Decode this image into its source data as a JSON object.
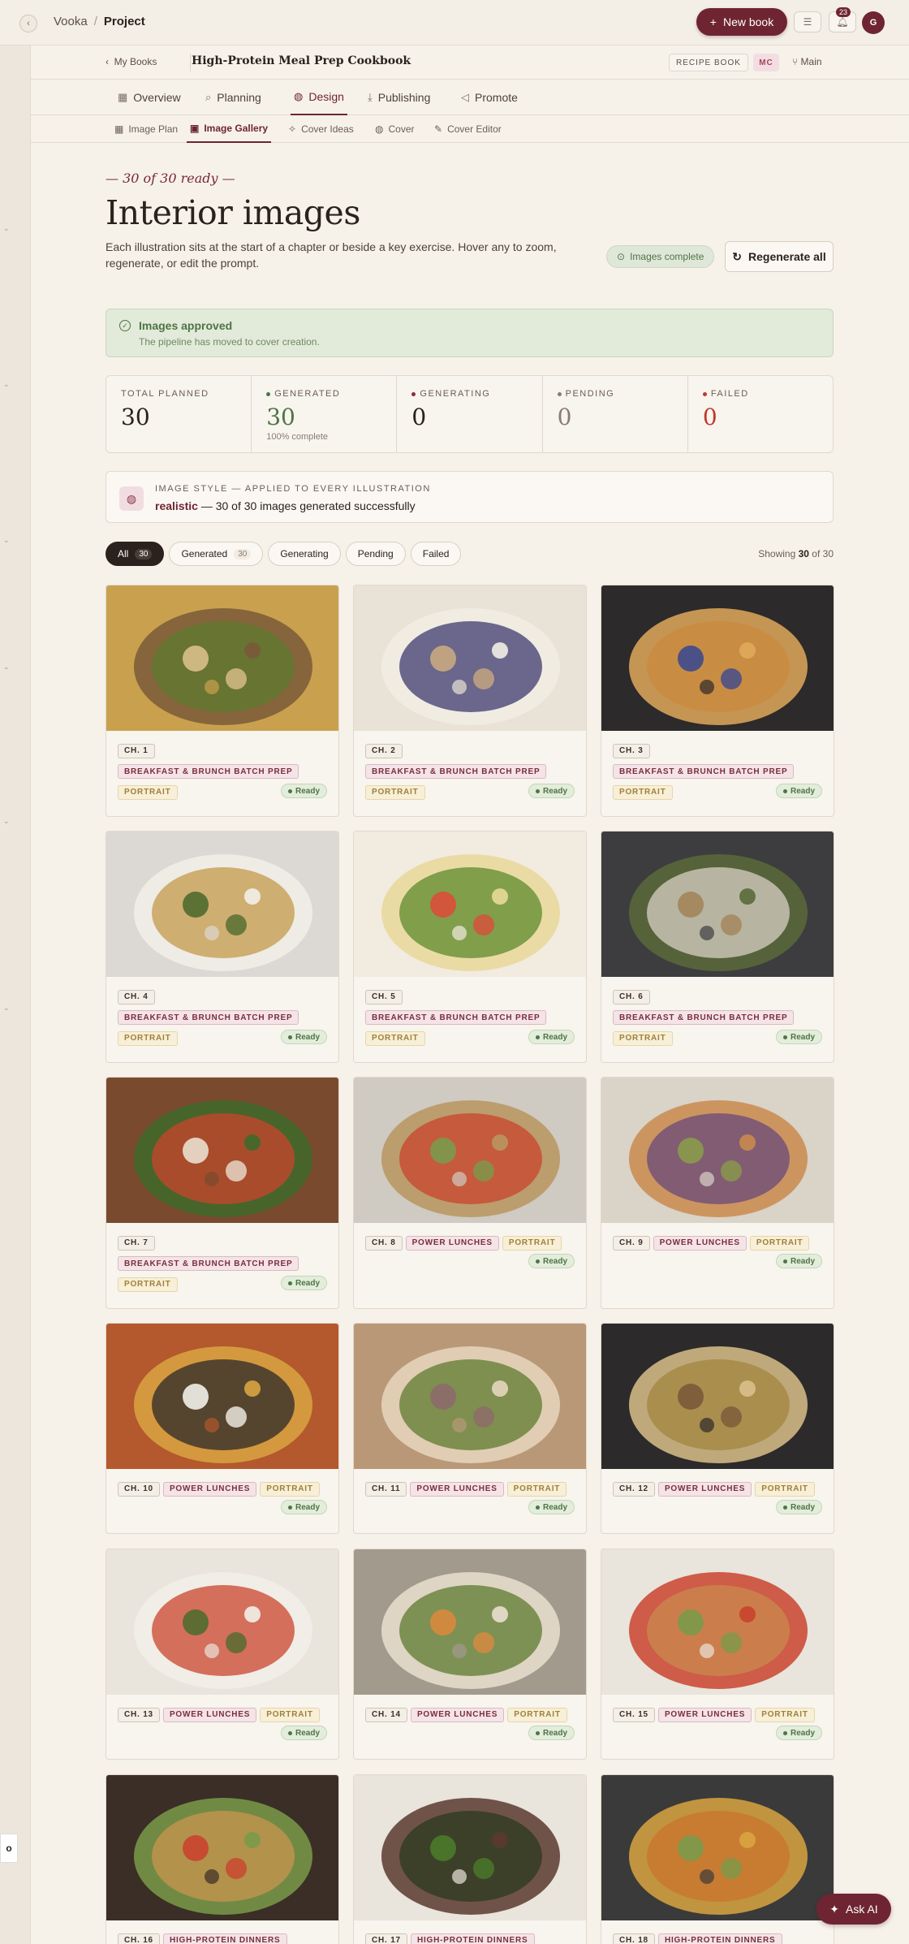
{
  "topbar": {
    "brand": "Vooka",
    "separator": "/",
    "current": "Project",
    "new_book_label": "New book",
    "notifications_count": "23",
    "avatar_initial": "G"
  },
  "bookbar": {
    "my_books": "My Books",
    "book_title": "High-Protein Meal Prep Cookbook",
    "type_tag": "RECIPE BOOK",
    "user_tag": "MC",
    "branch": "Main"
  },
  "tabs": [
    {
      "label": "Overview",
      "icon": "grid-icon"
    },
    {
      "label": "Planning",
      "icon": "search-icon"
    },
    {
      "label": "Design",
      "icon": "palette-icon"
    },
    {
      "label": "Publishing",
      "icon": "download-icon"
    },
    {
      "label": "Promote",
      "icon": "megaphone-icon"
    }
  ],
  "subtabs": [
    {
      "label": "Image Plan"
    },
    {
      "label": "Image Gallery"
    },
    {
      "label": "Cover Ideas"
    },
    {
      "label": "Cover"
    },
    {
      "label": "Cover Editor"
    }
  ],
  "header": {
    "eyebrow": "— 30 of 30 ready —",
    "title": "Interior images",
    "intro": "Each illustration sits at the start of a chapter or beside a key exercise. Hover any to zoom, regenerate, or edit the prompt.",
    "complete_pill": "Images complete",
    "regenerate_label": "Regenerate all"
  },
  "approved": {
    "title": "Images approved",
    "subtitle": "The pipeline has moved to cover creation."
  },
  "stats": [
    {
      "label": "TOTAL PLANNED",
      "value": "30",
      "sub": "",
      "dot": ""
    },
    {
      "label": "GENERATED",
      "value": "30",
      "sub": "100% complete",
      "dot": "#4f7445"
    },
    {
      "label": "GENERATING",
      "value": "0",
      "sub": "",
      "dot": "#8a2c3c"
    },
    {
      "label": "PENDING",
      "value": "0",
      "sub": "",
      "dot": "#8a7c71"
    },
    {
      "label": "FAILED",
      "value": "0",
      "sub": "",
      "dot": "#c0392b"
    }
  ],
  "style": {
    "label": "IMAGE STYLE — APPLIED TO EVERY ILLUSTRATION",
    "style_name": "realistic",
    "summary": " — 30 of 30 images generated successfully"
  },
  "filters": [
    {
      "label": "All",
      "count": "30"
    },
    {
      "label": "Generated",
      "count": "30"
    },
    {
      "label": "Generating",
      "count": ""
    },
    {
      "label": "Pending",
      "count": ""
    },
    {
      "label": "Failed",
      "count": ""
    }
  ],
  "showing": {
    "prefix": "Showing ",
    "count": "30",
    "suffix": " of 30"
  },
  "cards": [
    {
      "chapter": "CH. 1",
      "section": "BREAKFAST & BRUNCH BATCH PREP",
      "orientation": "PORTRAIT",
      "status": "Ready"
    },
    {
      "chapter": "CH. 2",
      "section": "BREAKFAST & BRUNCH BATCH PREP",
      "orientation": "PORTRAIT",
      "status": "Ready"
    },
    {
      "chapter": "CH. 3",
      "section": "BREAKFAST & BRUNCH BATCH PREP",
      "orientation": "PORTRAIT",
      "status": "Ready"
    },
    {
      "chapter": "CH. 4",
      "section": "BREAKFAST & BRUNCH BATCH PREP",
      "orientation": "PORTRAIT",
      "status": "Ready"
    },
    {
      "chapter": "CH. 5",
      "section": "BREAKFAST & BRUNCH BATCH PREP",
      "orientation": "PORTRAIT",
      "status": "Ready"
    },
    {
      "chapter": "CH. 6",
      "section": "BREAKFAST & BRUNCH BATCH PREP",
      "orientation": "PORTRAIT",
      "status": "Ready"
    },
    {
      "chapter": "CH. 7",
      "section": "BREAKFAST & BRUNCH BATCH PREP",
      "orientation": "PORTRAIT",
      "status": "Ready"
    },
    {
      "chapter": "CH. 8",
      "section": "POWER LUNCHES",
      "orientation": "PORTRAIT",
      "status": "Ready"
    },
    {
      "chapter": "CH. 9",
      "section": "POWER LUNCHES",
      "orientation": "PORTRAIT",
      "status": "Ready"
    },
    {
      "chapter": "CH. 10",
      "section": "POWER LUNCHES",
      "orientation": "PORTRAIT",
      "status": "Ready"
    },
    {
      "chapter": "CH. 11",
      "section": "POWER LUNCHES",
      "orientation": "PORTRAIT",
      "status": "Ready"
    },
    {
      "chapter": "CH. 12",
      "section": "POWER LUNCHES",
      "orientation": "PORTRAIT",
      "status": "Ready"
    },
    {
      "chapter": "CH. 13",
      "section": "POWER LUNCHES",
      "orientation": "PORTRAIT",
      "status": "Ready"
    },
    {
      "chapter": "CH. 14",
      "section": "POWER LUNCHES",
      "orientation": "PORTRAIT",
      "status": "Ready"
    },
    {
      "chapter": "CH. 15",
      "section": "POWER LUNCHES",
      "orientation": "PORTRAIT",
      "status": "Ready"
    },
    {
      "chapter": "CH. 16",
      "section": "HIGH-PROTEIN DINNERS",
      "orientation": "",
      "status": ""
    },
    {
      "chapter": "CH. 17",
      "section": "HIGH-PROTEIN DINNERS",
      "orientation": "",
      "status": ""
    },
    {
      "chapter": "CH. 18",
      "section": "HIGH-PROTEIN DINNERS",
      "orientation": "",
      "status": ""
    }
  ],
  "ask_ai": "Ask AI",
  "edge_label": "o",
  "colors": {
    "accent": "#6e2531",
    "success": "#4f7445",
    "background": "#f6f2ea"
  }
}
